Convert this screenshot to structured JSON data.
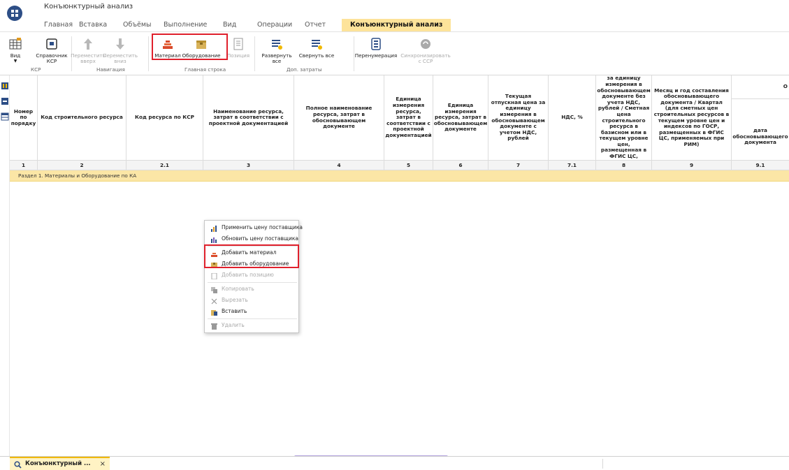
{
  "app": {
    "title": "Конъюнктурный анализ"
  },
  "menu": [
    "Главная",
    "Вставка",
    "Объёмы",
    "Выполнение",
    "Вид",
    "Операции",
    "Отчет",
    "Конъюнктурный анализ"
  ],
  "ribbon": {
    "buttons": {
      "view": "Вид",
      "ksr_ref": "Справочник КСР",
      "move_up": "Переместить вверх",
      "move_down": "Переместить вниз",
      "material": "Материал",
      "equipment": "Оборудование",
      "position": "Позиция",
      "expand_all": "Развернуть все",
      "collapse_all": "Свернуть все",
      "renumber": "Перенумерация",
      "sync_ssr": "Синхронизировать с ССР"
    },
    "groups": {
      "ksr": "КСР",
      "navigation": "Навигация",
      "main_row": "Главная строка",
      "extra_costs": "Доп. затраты"
    }
  },
  "table": {
    "headers": {
      "c1": "Номер по порядку",
      "c2": "Код строительного ресурса",
      "c21": "Код ресурса по КСР",
      "c3": "Наименование ресурса, затрат в соответствии с проектной документацией",
      "c4": "Полное наименование ресурса, затрат в обосновывающем документе",
      "c5": "Единица измерения ресурса, затрат в соответствии с проектной документацией",
      "c6": "Единица измерения ресурса, затрат в обосновывающем документе",
      "c7": "Текущая отпускная цена за единицу измерения в обосновывающем документе с учетом НДС, рублей",
      "c71": "НДС, %",
      "c8": "Текущая отпускная цена за единицу измерения в обосновывающем документе без учета НДС, рублей / Сметная цена строительного ресурса в базисном или в текущем уровне цен, размещенная в ФГИС ЦС, применяемая при РИМ, рублей",
      "c9": "Месяц и год составления обосновывающего документа / Квартал (для сметных цен строительных ресурсов в текущем уровне цен и индексов по ГОСР, размещенных в ФГИС ЦС, применяемых при РИМ)",
      "c91_top": "О",
      "c91": "дата обосновывающего документа"
    },
    "numbers": [
      "1",
      "2",
      "2.1",
      "3",
      "4",
      "5",
      "6",
      "7",
      "7.1",
      "8",
      "9",
      "9.1"
    ],
    "section": "Раздел 1. Материалы и Оборудование по КА"
  },
  "context_menu": {
    "apply_price": "Применить цену поставщика",
    "update_price": "Обновить цену поставщика",
    "add_material": "Добавить материал",
    "add_equipment": "Добавить оборудование",
    "add_position": "Добавить позицию",
    "copy": "Копировать",
    "cut": "Вырезать",
    "paste": "Вставить",
    "delete": "Удалить"
  },
  "bottom_tab": {
    "label": "Конъюнктурный ...",
    "close": "×"
  },
  "colors": {
    "accent": "#fde39a",
    "highlight": "#e0202c",
    "section": "#fbe6a6"
  }
}
